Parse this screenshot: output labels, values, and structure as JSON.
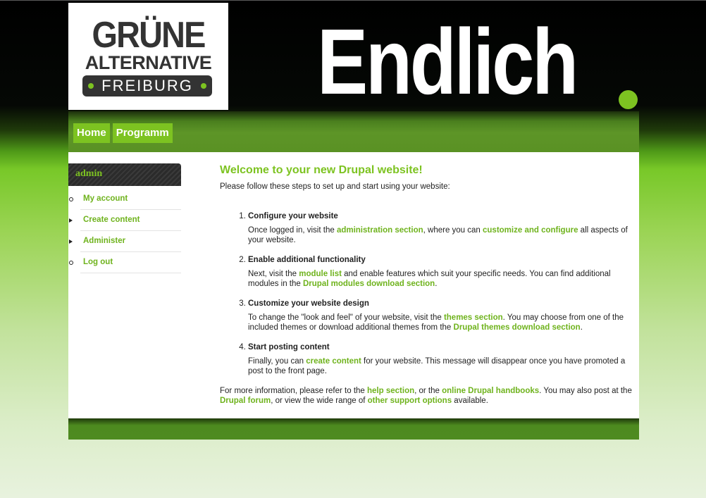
{
  "colors": {
    "accent": "#7dc321",
    "header_bg": "#000000",
    "nav_bg": "#5a9124",
    "content_bg": "#ffffff"
  },
  "header": {
    "logo": {
      "line1": "GRÜNE",
      "line2": "ALTERNATIVE",
      "line3": "FREIBURG"
    },
    "slogan": "Endlich"
  },
  "nav": {
    "items": [
      {
        "label": "Home"
      },
      {
        "label": "Programm"
      }
    ]
  },
  "sidebar": {
    "title": "admin",
    "items": [
      {
        "label": "My account",
        "bullet": "circle"
      },
      {
        "label": "Create content",
        "bullet": "triangle"
      },
      {
        "label": "Administer",
        "bullet": "triangle"
      },
      {
        "label": "Log out",
        "bullet": "circle"
      }
    ]
  },
  "main": {
    "title": "Welcome to your new Drupal website!",
    "intro": "Please follow these steps to set up and start using your website:",
    "steps": [
      {
        "number": "1.",
        "title": "Configure your website",
        "text1": "Once logged in, visit the ",
        "link1": "administration section",
        "text2": ", where you can ",
        "link2": "customize and configure",
        "text3": " all aspects of your website."
      },
      {
        "number": "2.",
        "title": "Enable additional functionality",
        "text1": "Next, visit the ",
        "link1": "module list",
        "text2": " and enable features which suit your specific needs. You can find additional modules in the ",
        "link2": "Drupal modules download section",
        "text3": "."
      },
      {
        "number": "3.",
        "title": "Customize your website design",
        "text1": "To change the \"look and feel\" of your website, visit the ",
        "link1": "themes section",
        "text2": ". You may choose from one of the included themes or download additional themes from the ",
        "link2": "Drupal themes download section",
        "text3": "."
      },
      {
        "number": "4.",
        "title": "Start posting content",
        "text1": "Finally, you can ",
        "link1": "create content",
        "text2": " for your website. This message will disappear once you have promoted a post to the front page.",
        "link2": "",
        "text3": ""
      }
    ],
    "more": {
      "t1": "For more information, please refer to the ",
      "l1": "help section",
      "t2": ", or the ",
      "l2": "online Drupal handbooks",
      "t3": ". You may also post at the ",
      "l3": "Drupal forum",
      "t4": ", or view the wide range of ",
      "l4": "other support options",
      "t5": " available."
    }
  }
}
